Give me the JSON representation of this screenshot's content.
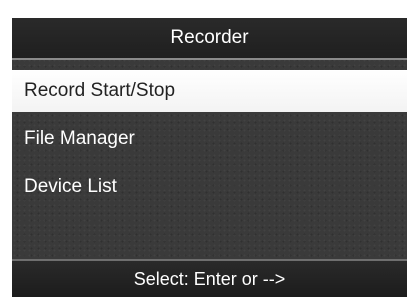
{
  "header": {
    "title": "Recorder"
  },
  "menu": {
    "items": [
      {
        "label": "Record Start/Stop",
        "selected": true
      },
      {
        "label": "File Manager",
        "selected": false
      },
      {
        "label": "Device List",
        "selected": false
      }
    ]
  },
  "footer": {
    "hint": "Select: Enter or -->"
  },
  "colors": {
    "screen_bg": "#3a3a3a",
    "bar_bg": "#1f1f1f",
    "selected_bg": "#ffffff",
    "selected_text": "#222222",
    "text": "#ffffff"
  }
}
